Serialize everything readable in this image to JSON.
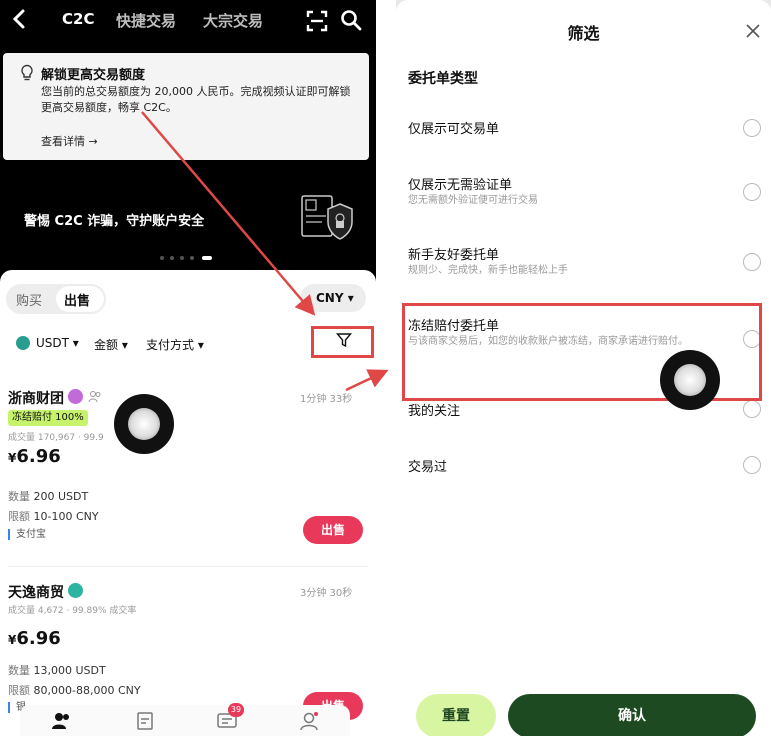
{
  "left": {
    "nav": {
      "back_icon": "chevron-left-icon",
      "tabs": [
        "C2C",
        "快捷交易",
        "大宗交易"
      ],
      "active_tab": "C2C",
      "scan_icon": "scan-icon",
      "search_icon": "search-icon"
    },
    "notice": {
      "title": "解锁更高交易额度",
      "body": "您当前的总交易额度为 20,000 人民币。完成视频认证即可解锁更高交易额度，畅享 C2C。",
      "link": "查看详情 →"
    },
    "banner": {
      "text": "警惕 C2C 诈骗，守护账户安全"
    },
    "segment": {
      "buy": "购买",
      "sell": "出售",
      "selected": "出售"
    },
    "currency": "CNY ▾",
    "filters": {
      "coin": "USDT ▾",
      "amount": "金额 ▾",
      "payment": "支付方式 ▾"
    },
    "merchants": [
      {
        "name": "浙商财团",
        "time": "1分钟 33秒",
        "tag": "冻结赔付 100%",
        "stats": "成交量 170,967 · 99.9",
        "price_symbol": "¥",
        "price": "6.96",
        "quantity_label": "数量",
        "quantity": "200 USDT",
        "limit_label": "限额",
        "limit": "10-100 CNY",
        "payment": "支付宝",
        "action": "出售"
      },
      {
        "name": "天逸商贸",
        "time": "3分钟 30秒",
        "stats": "成交量 4,672 · 99.89% 成交率",
        "price_symbol": "¥",
        "price": "6.96",
        "quantity_label": "数量",
        "quantity": "13,000 USDT",
        "limit_label": "限额",
        "limit": "80,000-88,000 CNY",
        "payment": "银",
        "action": "出售"
      }
    ],
    "bottom_nav": {
      "message_count": "39"
    }
  },
  "right": {
    "title": "筛选",
    "section": "委托单类型",
    "options": [
      {
        "title": "仅展示可交易单",
        "subtitle": ""
      },
      {
        "title": "仅展示无需验证单",
        "subtitle": "您无需额外验证便可进行交易"
      },
      {
        "title": "新手友好委托单",
        "subtitle": "规则少、完成快，新手也能轻松上手"
      },
      {
        "title": "冻结赔付委托单",
        "subtitle": "与该商家交易后，如您的收款账户被冻结，商家承诺进行赔付。"
      },
      {
        "title": "我的关注",
        "subtitle": ""
      },
      {
        "title": "交易过",
        "subtitle": ""
      }
    ],
    "reset": "重置",
    "confirm": "确认"
  },
  "colors": {
    "accent_red": "#e04848",
    "sell_button": "#e8395a",
    "confirm_button": "#1e4a22",
    "reset_button": "#d8f5a2",
    "tag_green": "#c6f36b"
  }
}
